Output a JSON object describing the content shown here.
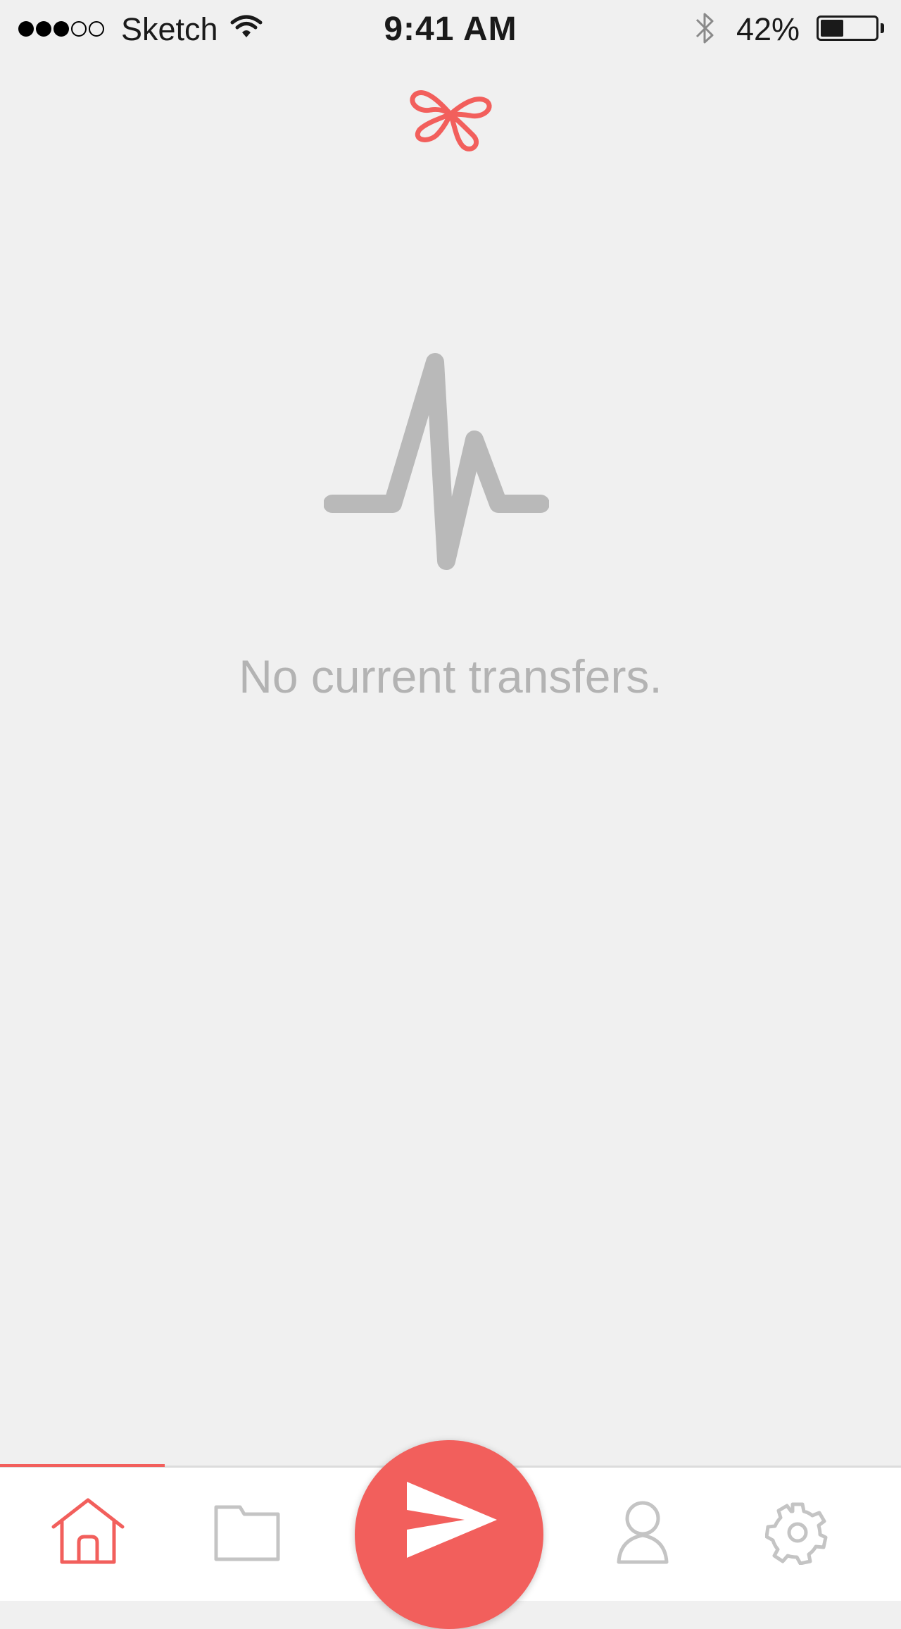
{
  "status_bar": {
    "carrier": "Sketch",
    "time": "9:41 AM",
    "battery_percent": "42%",
    "battery_level": 0.42,
    "signal_bars_filled": 3,
    "signal_bars_total": 5
  },
  "empty_state": {
    "message": "No current transfers.",
    "icon": "pulse-icon"
  },
  "logo": {
    "icon": "cloverleaf-logo-icon",
    "color": "#f25f5c"
  },
  "tab_bar": {
    "active_tab": "home",
    "tabs": [
      {
        "id": "home",
        "icon": "home-icon"
      },
      {
        "id": "files",
        "icon": "folder-icon"
      },
      {
        "id": "send",
        "icon": "send-icon"
      },
      {
        "id": "profile",
        "icon": "person-icon"
      },
      {
        "id": "settings",
        "icon": "gear-icon"
      }
    ]
  },
  "colors": {
    "accent": "#f25f5c",
    "background": "#f0f0f0",
    "muted": "#b3b3b3",
    "inactive_icon": "#c4c4c4"
  }
}
